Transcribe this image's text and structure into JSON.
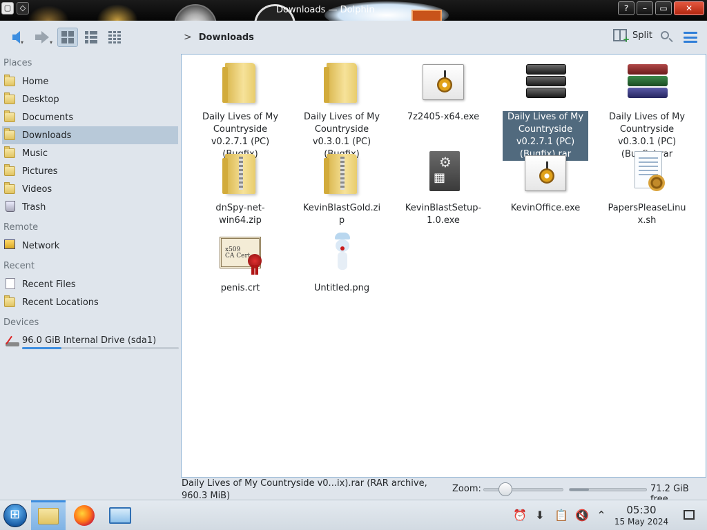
{
  "window": {
    "title": "Downloads — Dolphin",
    "controls": {
      "help": "?",
      "minimize": "–",
      "maximize": "▭",
      "close": "✕"
    }
  },
  "toolbar": {
    "back": "back-arrow-icon",
    "forward": "forward-arrow-icon",
    "view_icons": "icons-view-icon",
    "view_compact": "compact-view-icon",
    "view_details": "details-view-icon",
    "breadcrumb_sep": ">",
    "breadcrumb": "Downloads",
    "split_label": "Split",
    "search": "search-icon",
    "menu": "hamburger-menu-icon"
  },
  "sidebar": {
    "places_header": "Places",
    "places": [
      {
        "label": "Home",
        "icon": "home-folder-icon"
      },
      {
        "label": "Desktop",
        "icon": "desktop-folder-icon"
      },
      {
        "label": "Documents",
        "icon": "documents-folder-icon"
      },
      {
        "label": "Downloads",
        "icon": "downloads-folder-icon",
        "selected": true
      },
      {
        "label": "Music",
        "icon": "music-folder-icon"
      },
      {
        "label": "Pictures",
        "icon": "pictures-folder-icon"
      },
      {
        "label": "Videos",
        "icon": "videos-folder-icon"
      },
      {
        "label": "Trash",
        "icon": "trash-icon"
      }
    ],
    "remote_header": "Remote",
    "remote": [
      {
        "label": "Network",
        "icon": "network-folder-icon"
      }
    ],
    "recent_header": "Recent",
    "recent": [
      {
        "label": "Recent Files",
        "icon": "recent-files-icon"
      },
      {
        "label": "Recent Locations",
        "icon": "recent-locations-icon"
      }
    ],
    "devices_header": "Devices",
    "devices": [
      {
        "label": "96.0 GiB Internal Drive (sda1)",
        "icon": "hard-drive-icon",
        "usage_fraction": 0.25
      }
    ]
  },
  "files": [
    {
      "name": "Daily Lives of My Countryside v0.2.7.1 (PC) (Bugfix)",
      "type": "folder"
    },
    {
      "name": "Daily Lives of My Countryside v0.3.0.1 (PC) (Bugfix)",
      "type": "folder"
    },
    {
      "name": "7z2405-x64.exe",
      "type": "exe"
    },
    {
      "name": "Daily Lives of My Countryside v0.2.7.1 (PC) (Bugfix).rar",
      "type": "rar",
      "selected": true
    },
    {
      "name": "Daily Lives of My Countryside v0.3.0.1 (PC) (Bugfix).rar",
      "type": "rar-color"
    },
    {
      "name": "dnSpy-net-win64.zip",
      "type": "zip"
    },
    {
      "name": "KevinBlastGold.zip",
      "type": "zip"
    },
    {
      "name": "KevinBlastSetup-1.0.exe",
      "type": "setup"
    },
    {
      "name": "KevinOffice.exe",
      "type": "exe"
    },
    {
      "name": "PapersPleaseLinux.sh",
      "type": "script"
    },
    {
      "name": "penis.crt",
      "type": "certificate",
      "icon_text": "x509\nCA Cert"
    },
    {
      "name": "Untitled.png",
      "type": "image"
    }
  ],
  "statusbar": {
    "selection_info": "Daily Lives of My Countryside v0...ix).rar (RAR archive, 960.3 MiB)",
    "zoom_label": "Zoom:",
    "zoom_level": 0.25,
    "free_space_text": "71.2 GiB free",
    "used_fraction": 0.25
  },
  "taskbar": {
    "start": "start-orb-icon",
    "apps": [
      {
        "name": "file-manager",
        "icon": "folder-icon",
        "active": true
      },
      {
        "name": "firefox",
        "icon": "firefox-icon",
        "active": false
      },
      {
        "name": "system-monitor",
        "icon": "monitor-icon",
        "active": false
      }
    ],
    "tray": [
      "notifications-icon",
      "updates-icon",
      "clipboard-icon",
      "volume-muted-icon",
      "tray-expand-icon"
    ],
    "time": "05:30",
    "date": "15 May 2024"
  },
  "colors": {
    "accent": "#3d8ee0",
    "selection_bg": "#516a7e",
    "sidebar_selected": "#b8c9d9",
    "chrome_bg": "#dfe5ec"
  }
}
